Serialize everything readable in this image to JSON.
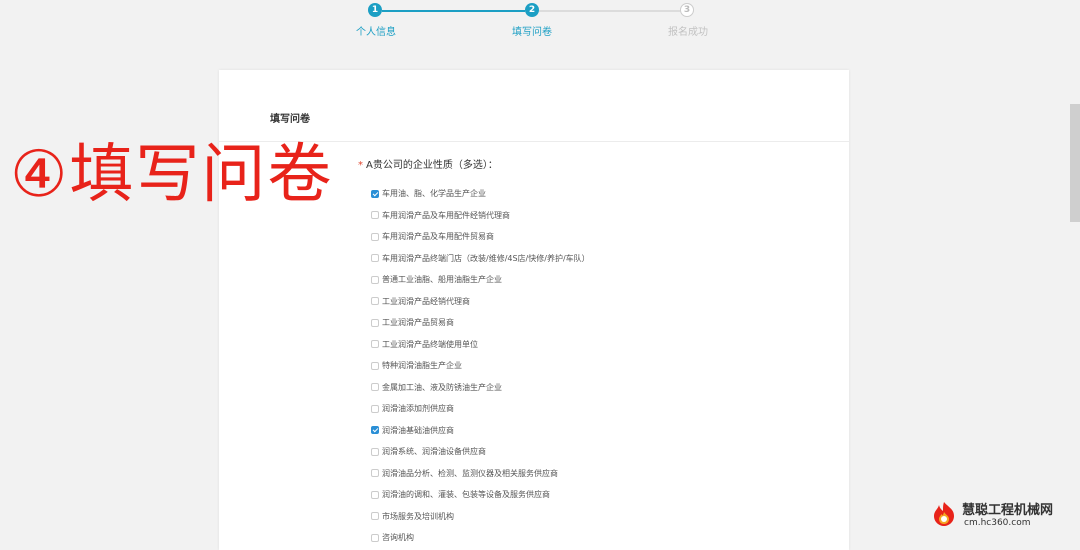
{
  "stepper": {
    "steps": [
      {
        "num": "1",
        "label": "个人信息",
        "state": "done"
      },
      {
        "num": "2",
        "label": "填写问卷",
        "state": "current"
      },
      {
        "num": "3",
        "label": "报名成功",
        "state": "pending"
      }
    ]
  },
  "card": {
    "title": "填写问卷",
    "question": {
      "required_mark": "*",
      "text": "A贵公司的企业性质（多选）：",
      "options": [
        {
          "label": "车用油、脂、化学品生产企业",
          "checked": true
        },
        {
          "label": "车用润滑产品及车用配件经销代理商",
          "checked": false
        },
        {
          "label": "车用润滑产品及车用配件贸易商",
          "checked": false
        },
        {
          "label": "车用润滑产品终端门店（改装/维修/4S店/快修/养护/车队）",
          "checked": false
        },
        {
          "label": "普通工业油脂、船用油脂生产企业",
          "checked": false
        },
        {
          "label": "工业润滑产品经销代理商",
          "checked": false
        },
        {
          "label": "工业润滑产品贸易商",
          "checked": false
        },
        {
          "label": "工业润滑产品终端使用单位",
          "checked": false
        },
        {
          "label": "特种润滑油脂生产企业",
          "checked": false
        },
        {
          "label": "金属加工油、液及防锈油生产企业",
          "checked": false
        },
        {
          "label": "润滑油添加剂供应商",
          "checked": false
        },
        {
          "label": "润滑油基础油供应商",
          "checked": true
        },
        {
          "label": "润滑系统、润滑油设备供应商",
          "checked": false
        },
        {
          "label": "润滑油品分析、检测、监测仪器及相关服务供应商",
          "checked": false
        },
        {
          "label": "润滑油的调和、灌装、包装等设备及服务供应商",
          "checked": false
        },
        {
          "label": "市场服务及培训机构",
          "checked": false
        },
        {
          "label": "咨询机构",
          "checked": false
        }
      ]
    }
  },
  "overlay": {
    "text": "④填写问卷"
  },
  "watermark": {
    "name": "慧聪工程机械网",
    "url": "cm.hc360.com"
  },
  "colors": {
    "accent": "#1c9fc4",
    "checkbox": "#2a8fd6",
    "overlay": "#e8231a"
  }
}
